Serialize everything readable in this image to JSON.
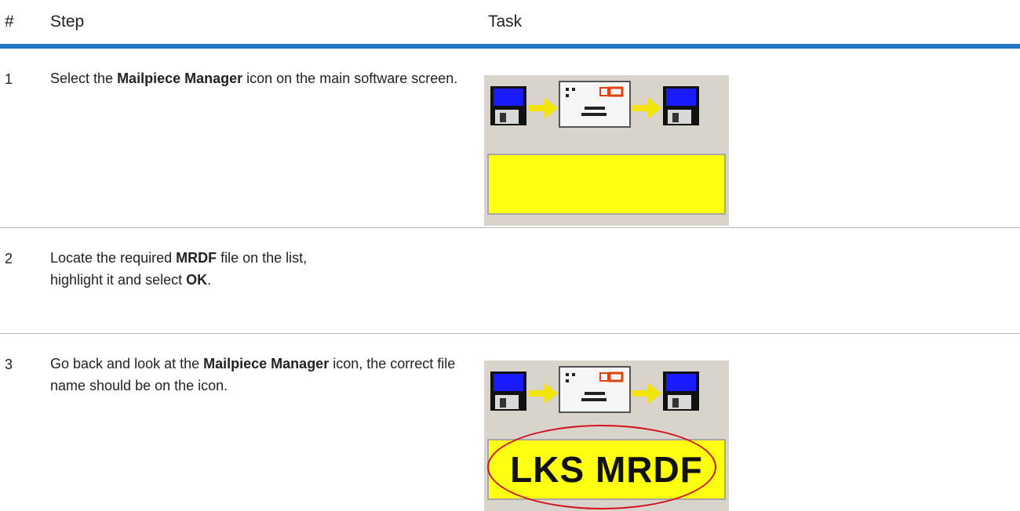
{
  "table": {
    "headers": {
      "num": "#",
      "step": "Step",
      "task": "Task"
    },
    "rows": [
      {
        "num": "1",
        "parts": [
          {
            "t": "Select the ",
            "b": false
          },
          {
            "t": "Mailpiece Manager",
            "b": true
          },
          {
            "t": " icon on the main software screen.",
            "b": false
          }
        ],
        "image": {
          "icon_name": "mailpiece-manager-icon",
          "label_text": "",
          "highlighted": false
        }
      },
      {
        "num": "2",
        "parts": [
          {
            "t": "Locate the required ",
            "b": false
          },
          {
            "t": "MRDF",
            "b": true
          },
          {
            "t": " file on the list,",
            "b": false
          },
          {
            "t": "\n",
            "b": false
          },
          {
            "t": "highlight it and select ",
            "b": false
          },
          {
            "t": "OK",
            "b": true
          },
          {
            "t": ".",
            "b": false
          }
        ]
      },
      {
        "num": "3",
        "parts": [
          {
            "t": "Go back and look at the ",
            "b": false
          },
          {
            "t": "Mailpiece Manager",
            "b": true
          },
          {
            "t": " icon, the correct file name should be on the icon.",
            "b": false
          }
        ],
        "image": {
          "icon_name": "mailpiece-manager-icon",
          "label_text": "LKS MRDF",
          "highlighted": true
        }
      }
    ]
  },
  "colors": {
    "header_rule": "#1f77c6",
    "row_separator": "#b8b8b8",
    "icon_yellow": "#ffff12",
    "highlight_red": "#d4121f"
  }
}
